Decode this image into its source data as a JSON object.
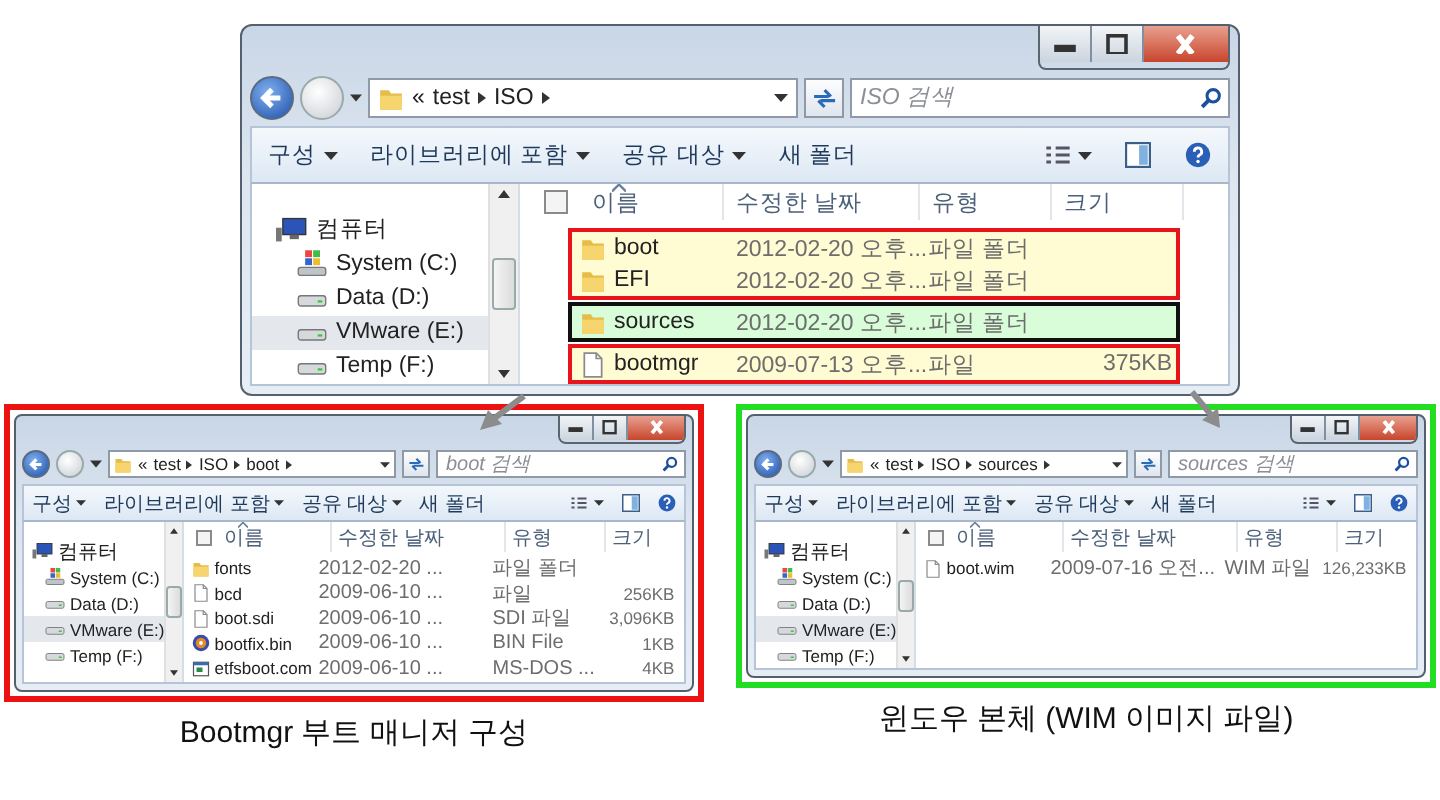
{
  "windows": [
    {
      "kind": "large",
      "select_all_checked": false,
      "path_prefix": "«",
      "path": [
        "test",
        "ISO"
      ],
      "search_placeholder": "ISO 검색",
      "toolbar": [
        {
          "label": "구성",
          "dropdown": true
        },
        {
          "label": "라이브러리에 포함",
          "dropdown": true
        },
        {
          "label": "공유 대상",
          "dropdown": true
        },
        {
          "label": "새 폴더",
          "dropdown": false
        }
      ],
      "columns": [
        "이름",
        "수정한 날짜",
        "유형",
        "크기"
      ],
      "sidebar": {
        "label": "컴퓨터",
        "children": [
          {
            "label": "System (C:)",
            "kind": "system",
            "selected": false
          },
          {
            "label": "Data (D:)",
            "kind": "drive",
            "selected": false
          },
          {
            "label": "VMware (E:)",
            "kind": "drive",
            "selected": true
          },
          {
            "label": "Temp (F:)",
            "kind": "drive",
            "selected": false
          }
        ]
      },
      "groups": [
        {
          "color": "#e8141c",
          "kind": "marked",
          "rows": [
            {
              "kind": "folder",
              "name": "boot",
              "date": "2012-02-20 오후...",
              "type": "파일 폴더"
            },
            {
              "kind": "folder",
              "name": "EFI",
              "date": "2012-02-20 오후...",
              "type": "파일 폴더"
            }
          ]
        },
        {
          "color": "#101010",
          "kind": "current",
          "rows": [
            {
              "kind": "folder",
              "name": "sources",
              "date": "2012-02-20 오후...",
              "type": "파일 폴더"
            }
          ]
        },
        {
          "color": "#e8141c",
          "kind": "marked",
          "rows": [
            {
              "kind": "file",
              "name": "bootmgr",
              "date": "2009-07-13 오후...",
              "type": "파일",
              "size": "375KB"
            }
          ]
        }
      ]
    },
    {
      "kind": "small",
      "color": "#ee1111",
      "caption": "Bootmgr 부트 매니저 구성",
      "select_all_checked": false,
      "path_prefix": "«",
      "path": [
        "test",
        "ISO",
        "boot"
      ],
      "search_placeholder": "boot 검색",
      "toolbar": [
        {
          "label": "구성",
          "dropdown": true
        },
        {
          "label": "라이브러리에 포함",
          "dropdown": true
        },
        {
          "label": "공유 대상",
          "dropdown": true
        },
        {
          "label": "새 폴더",
          "dropdown": false
        }
      ],
      "columns": [
        "이름",
        "수정한 날짜",
        "유형",
        "크기"
      ],
      "sidebar": {
        "label": "컴퓨터",
        "children": [
          {
            "label": "System (C:)",
            "kind": "system",
            "selected": false
          },
          {
            "label": "Data (D:)",
            "kind": "drive",
            "selected": false
          },
          {
            "label": "VMware (E:)",
            "kind": "drive",
            "selected": true
          },
          {
            "label": "Temp (F:)",
            "kind": "drive",
            "selected": false
          }
        ]
      },
      "groups": [
        {
          "rows": [
            {
              "kind": "folder",
              "name": "fonts",
              "date": "2012-02-20 ...",
              "type": "파일 폴더"
            },
            {
              "kind": "file",
              "name": "bcd",
              "date": "2009-06-10 ...",
              "type": "파일",
              "size": "256KB"
            },
            {
              "kind": "file",
              "name": "boot.sdi",
              "date": "2009-06-10 ...",
              "type": "SDI 파일",
              "size": "3,096KB"
            },
            {
              "kind": "bin",
              "name": "bootfix.bin",
              "date": "2009-06-10 ...",
              "type": "BIN File",
              "size": "1KB"
            },
            {
              "kind": "app",
              "name": "etfsboot.com",
              "date": "2009-06-10 ...",
              "type": "MS-DOS ...",
              "size": "4KB"
            }
          ]
        }
      ]
    },
    {
      "kind": "small",
      "color": "#22dd22",
      "caption": "윈도우 본체 (WIM 이미지 파일)",
      "select_all_checked": false,
      "path_prefix": "«",
      "path": [
        "test",
        "ISO",
        "sources"
      ],
      "search_placeholder": "sources 검색",
      "toolbar": [
        {
          "label": "구성",
          "dropdown": true
        },
        {
          "label": "라이브러리에 포함",
          "dropdown": true
        },
        {
          "label": "공유 대상",
          "dropdown": true
        },
        {
          "label": "새 폴더",
          "dropdown": false
        }
      ],
      "columns": [
        "이름",
        "수정한 날짜",
        "유형",
        "크기"
      ],
      "sidebar": {
        "label": "컴퓨터",
        "children": [
          {
            "label": "System (C:)",
            "kind": "system",
            "selected": false
          },
          {
            "label": "Data (D:)",
            "kind": "drive",
            "selected": false
          },
          {
            "label": "VMware (E:)",
            "kind": "drive",
            "selected": true
          },
          {
            "label": "Temp (F:)",
            "kind": "drive",
            "selected": false
          }
        ]
      },
      "groups": [
        {
          "rows": [
            {
              "kind": "file",
              "name": "boot.wim",
              "date": "2009-07-16 오전...",
              "type": "WIM 파일",
              "size": "126,233KB"
            }
          ]
        }
      ]
    }
  ]
}
